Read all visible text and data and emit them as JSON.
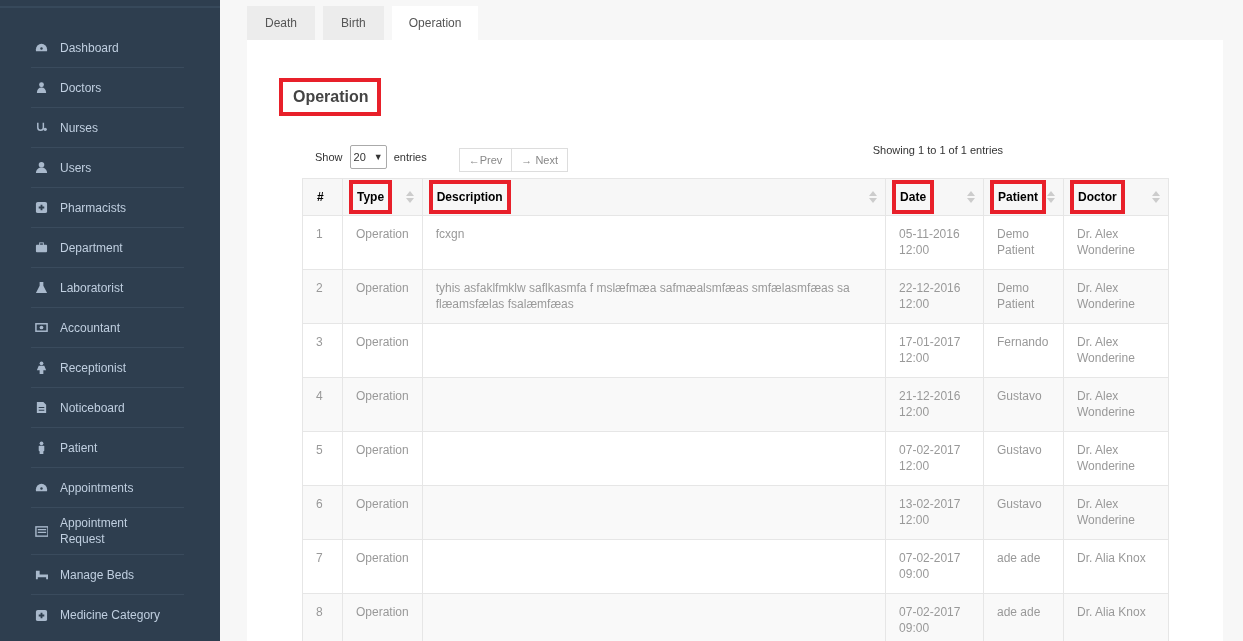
{
  "sidebar": {
    "items": [
      {
        "label": "Dashboard"
      },
      {
        "label": "Doctors"
      },
      {
        "label": "Nurses"
      },
      {
        "label": "Users"
      },
      {
        "label": "Pharmacists"
      },
      {
        "label": "Department"
      },
      {
        "label": "Laboratorist"
      },
      {
        "label": "Accountant"
      },
      {
        "label": "Receptionist"
      },
      {
        "label": "Noticeboard"
      },
      {
        "label": "Patient"
      },
      {
        "label": "Appointments"
      },
      {
        "label": "Appointment Request"
      },
      {
        "label": "Manage Beds"
      },
      {
        "label": "Medicine Category"
      }
    ]
  },
  "tabs": [
    {
      "label": "Death",
      "selected": false
    },
    {
      "label": "Birth",
      "selected": false
    },
    {
      "label": "Operation",
      "selected": true
    }
  ],
  "panel": {
    "title": "Operation",
    "title_highlighted": true,
    "length_menu": {
      "show_label": "Show",
      "value": "20",
      "arrow": "▼",
      "entries_label": "entries"
    },
    "pager": {
      "prev": "←Prev",
      "next": "→ Next"
    },
    "info": "Showing 1 to 1 of 1 entries",
    "table": {
      "columns": [
        {
          "label": "#",
          "sortable": false,
          "highlighted": false
        },
        {
          "label": "Type",
          "sortable": true,
          "highlighted": true
        },
        {
          "label": "Description",
          "sortable": true,
          "highlighted": true
        },
        {
          "label": "Date",
          "sortable": true,
          "highlighted": true
        },
        {
          "label": "Patient",
          "sortable": true,
          "highlighted": true
        },
        {
          "label": "Doctor",
          "sortable": true,
          "highlighted": true
        }
      ],
      "rows": [
        [
          "1",
          "Operation",
          "fcxgn",
          "05-11-2016 12:00",
          "Demo Patient",
          "Dr. Alex Wonderine"
        ],
        [
          "2",
          "Operation",
          "tyhis asfaklfmklw saflkasmfa f mslæfmæa safmæalsmfæas smfælasmfæas sa flæamsfælas fsalæmfæas",
          "22-12-2016 12:00",
          "Demo Patient",
          "Dr. Alex Wonderine"
        ],
        [
          "3",
          "Operation",
          "",
          "17-01-2017 12:00",
          "Fernando",
          "Dr. Alex Wonderine"
        ],
        [
          "4",
          "Operation",
          "",
          "21-12-2016 12:00",
          "Gustavo",
          "Dr. Alex Wonderine"
        ],
        [
          "5",
          "Operation",
          "",
          "07-02-2017 12:00",
          "Gustavo",
          "Dr. Alex Wonderine"
        ],
        [
          "6",
          "Operation",
          "",
          "13-02-2017 12:00",
          "Gustavo",
          "Dr. Alex Wonderine"
        ],
        [
          "7",
          "Operation",
          "",
          "07-02-2017 09:00",
          "ade ade",
          "Dr. Alia Knox"
        ],
        [
          "8",
          "Operation",
          "",
          "07-02-2017 09:00",
          "ade ade",
          "Dr. Alia Knox"
        ]
      ]
    }
  }
}
